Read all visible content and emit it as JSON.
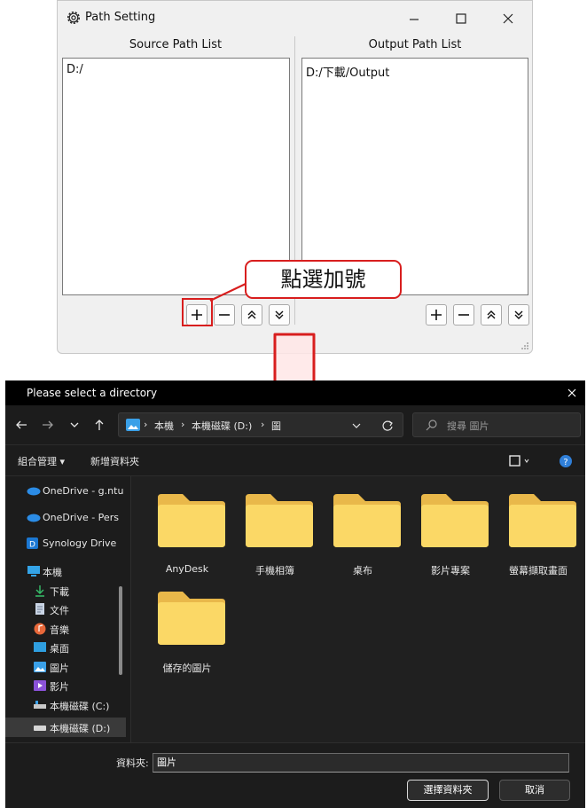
{
  "path_setting": {
    "title": "Path Setting",
    "source_header": "Source Path List",
    "output_header": "Output Path List",
    "source_items": [
      "D:/"
    ],
    "output_items": [
      "D:/下載/Output"
    ]
  },
  "annotation": {
    "callout": "點選加號",
    "color": "#d81e1e"
  },
  "dialog": {
    "title": "Please select a directory",
    "breadcrumb": [
      "本機",
      "本機磁碟 (D:)",
      "圖"
    ],
    "search_placeholder": "搜尋 圖片",
    "commands": {
      "organize": "組合管理 ▾",
      "new_folder": "新增資料夾"
    },
    "nav_items": [
      {
        "label": "OneDrive - g.ntu",
        "icon": "cloud-icon"
      },
      {
        "label": "OneDrive - Pers",
        "icon": "cloud-icon"
      },
      {
        "label": "Synology Drive",
        "icon": "synology-icon"
      },
      {
        "label": "本機",
        "icon": "computer-icon"
      },
      {
        "label": "下載",
        "icon": "download-icon"
      },
      {
        "label": "文件",
        "icon": "document-icon"
      },
      {
        "label": "音樂",
        "icon": "music-icon"
      },
      {
        "label": "桌面",
        "icon": "desktop-icon"
      },
      {
        "label": "圖片",
        "icon": "pictures-icon"
      },
      {
        "label": "影片",
        "icon": "videos-icon"
      },
      {
        "label": "本機磁碟 (C:)",
        "icon": "drive-icon"
      },
      {
        "label": "本機磁碟 (D:)",
        "icon": "drive-icon"
      }
    ],
    "folders": [
      "AnyDesk",
      "手機相簿",
      "桌布",
      "影片專案",
      "螢幕擷取畫面",
      "儲存的圖片"
    ],
    "folder_label": "資料夾:",
    "folder_value": "圖片",
    "select_button": "選擇資料夾",
    "cancel_button": "取消"
  }
}
